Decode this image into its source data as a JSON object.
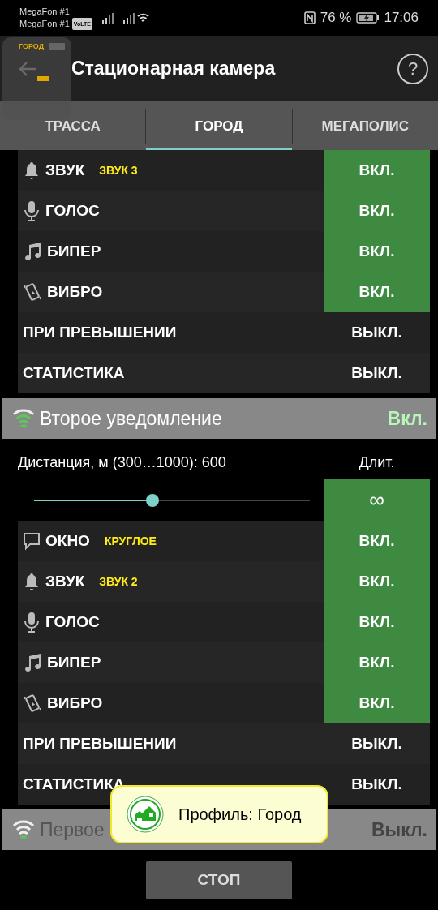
{
  "status_bar": {
    "carriers": [
      "MegaFon #1",
      "MegaFon #1"
    ],
    "volte": "VoLTE",
    "battery": "76 %",
    "time": "17:06"
  },
  "app_bar": {
    "title": "Стационарная камера",
    "help": "?"
  },
  "floating_widget": {
    "label": "ГОРОД"
  },
  "tabs": [
    {
      "label": "ТРАССА",
      "selected": false
    },
    {
      "label": "ГОРОД",
      "selected": true
    },
    {
      "label": "МЕГАПОЛИС",
      "selected": false
    }
  ],
  "sections": [
    {
      "kind": "rows",
      "rows": [
        {
          "kind": "bell",
          "label": "ЗВУК",
          "option": "ЗВУК 3",
          "value": "ВКЛ.",
          "on": true
        },
        {
          "kind": "mic",
          "label": "ГОЛОС",
          "value": "ВКЛ.",
          "on": true
        },
        {
          "kind": "note",
          "label": "БИПЕР",
          "value": "ВКЛ.",
          "on": true
        },
        {
          "kind": "vibrate",
          "label": "ВИБРО",
          "value": "ВКЛ.",
          "on": true
        },
        {
          "kind": "plain",
          "label": "ПРИ ПРЕВЫШЕНИИ",
          "value": "ВЫКЛ.",
          "on": false
        },
        {
          "kind": "plain",
          "label": "СТАТИСТИКА",
          "value": "ВЫКЛ.",
          "on": false
        }
      ]
    },
    {
      "kind": "notification",
      "title": "Второе уведомление",
      "status": "Вкл.",
      "on": true,
      "distance_label": "Дистанция, м (300…1000): 600",
      "duration_label": "Длит.",
      "level": 0.43,
      "duration": "∞",
      "rows": [
        {
          "kind": "chat",
          "label": "ОКНО",
          "option": "КРУГЛОЕ",
          "value": "ВКЛ.",
          "on": true
        },
        {
          "kind": "bell",
          "label": "ЗВУК",
          "option": "ЗВУК 2",
          "value": "ВКЛ.",
          "on": true
        },
        {
          "kind": "mic",
          "label": "ГОЛОС",
          "value": "ВКЛ.",
          "on": true
        },
        {
          "kind": "note",
          "label": "БИПЕР",
          "value": "ВКЛ.",
          "on": true
        },
        {
          "kind": "vibrate",
          "label": "ВИБРО",
          "value": "ВКЛ.",
          "on": true
        },
        {
          "kind": "plain",
          "label": "ПРИ ПРЕВЫШЕНИИ",
          "value": "ВЫКЛ.",
          "on": false
        },
        {
          "kind": "plain",
          "label": "СТАТИСТИКА",
          "value": "ВЫКЛ.",
          "on": false
        }
      ]
    },
    {
      "kind": "notification",
      "title": "Первое",
      "status": "Выкл.",
      "on": false
    }
  ],
  "toast": {
    "text": "Профиль: Город"
  },
  "stop_button": {
    "label": "СТОП"
  }
}
